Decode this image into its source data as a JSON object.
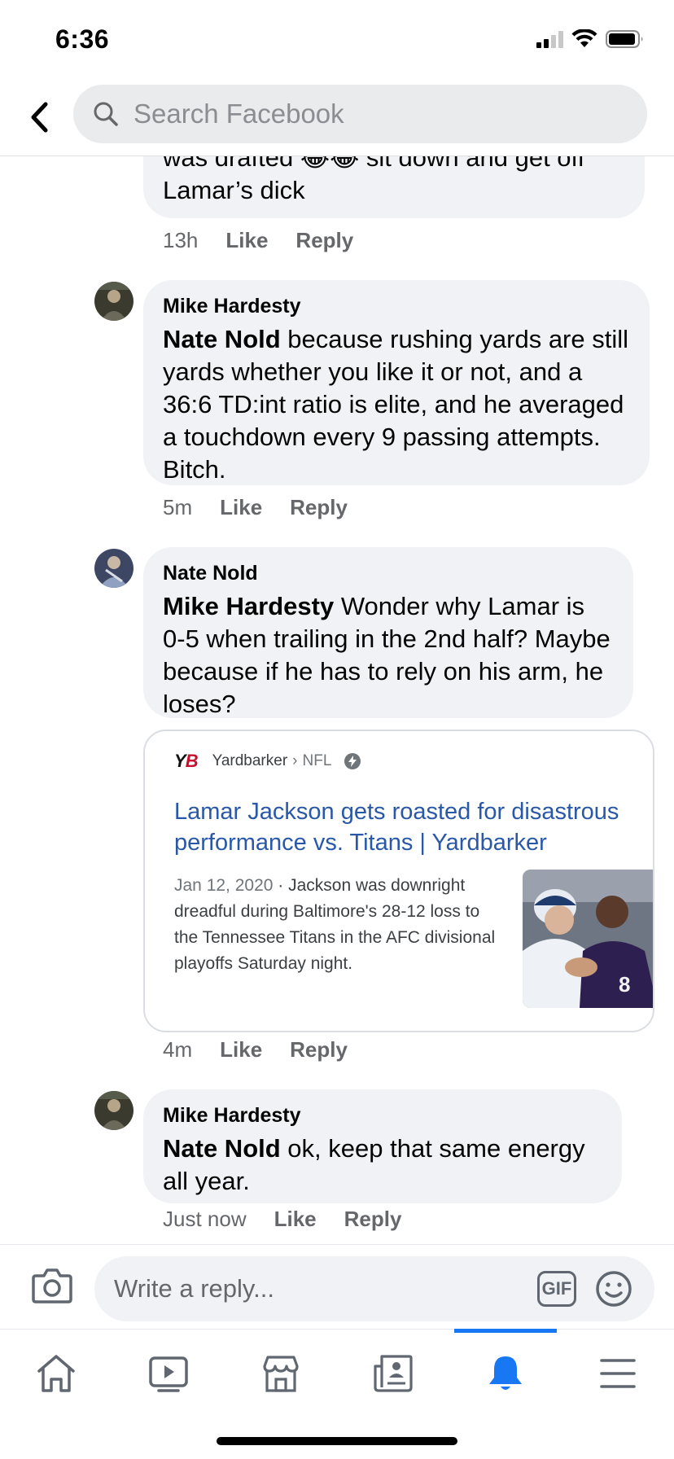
{
  "status": {
    "time": "6:36"
  },
  "search": {
    "placeholder": "Search Facebook"
  },
  "comments": [
    {
      "text": "was drafted 😂😂 sit down and get off Lamar’s dick",
      "time": "13h",
      "like": "Like",
      "reply": "Reply"
    },
    {
      "author": "Mike Hardesty",
      "mention": "Nate Nold",
      "text": " because rushing yards are still yards whether you like it or not, and a 36:6 TD:int ratio is elite, and he averaged a touchdown every 9 passing attempts. Bitch.",
      "time": "5m",
      "like": "Like",
      "reply": "Reply"
    },
    {
      "author": "Nate Nold",
      "mention": "Mike Hardesty",
      "text": " Wonder why Lamar is 0-5 when trailing in the 2nd half? Maybe because if he has to rely on his arm, he loses?",
      "time": "4m",
      "like": "Like",
      "reply": "Reply",
      "link_card": {
        "logo_y": "Y",
        "logo_b": "B",
        "source": "Yardbarker",
        "separator": "›",
        "section": "NFL",
        "title": "Lamar Jackson gets roasted for disastrous performance vs. Titans | Yardbarker",
        "date": "Jan 12, 2020",
        "snippet": " · Jackson was downright dreadful during Baltimore's 28-12 loss to the Tennessee Titans in the AFC divisional playoffs Saturday night."
      }
    },
    {
      "author": "Mike Hardesty",
      "mention": "Nate Nold",
      "text": " ok, keep that same energy all year.",
      "time": "Just now",
      "like": "Like",
      "reply": "Reply"
    }
  ],
  "composer": {
    "placeholder": "Write a reply...",
    "gif": "GIF"
  },
  "tabs": {
    "home": "home-icon",
    "watch": "video-icon",
    "marketplace": "marketplace-icon",
    "news": "news-icon",
    "notifications": "bell-icon",
    "menu": "menu-icon",
    "active": "notifications",
    "accent": "#1877f2"
  }
}
